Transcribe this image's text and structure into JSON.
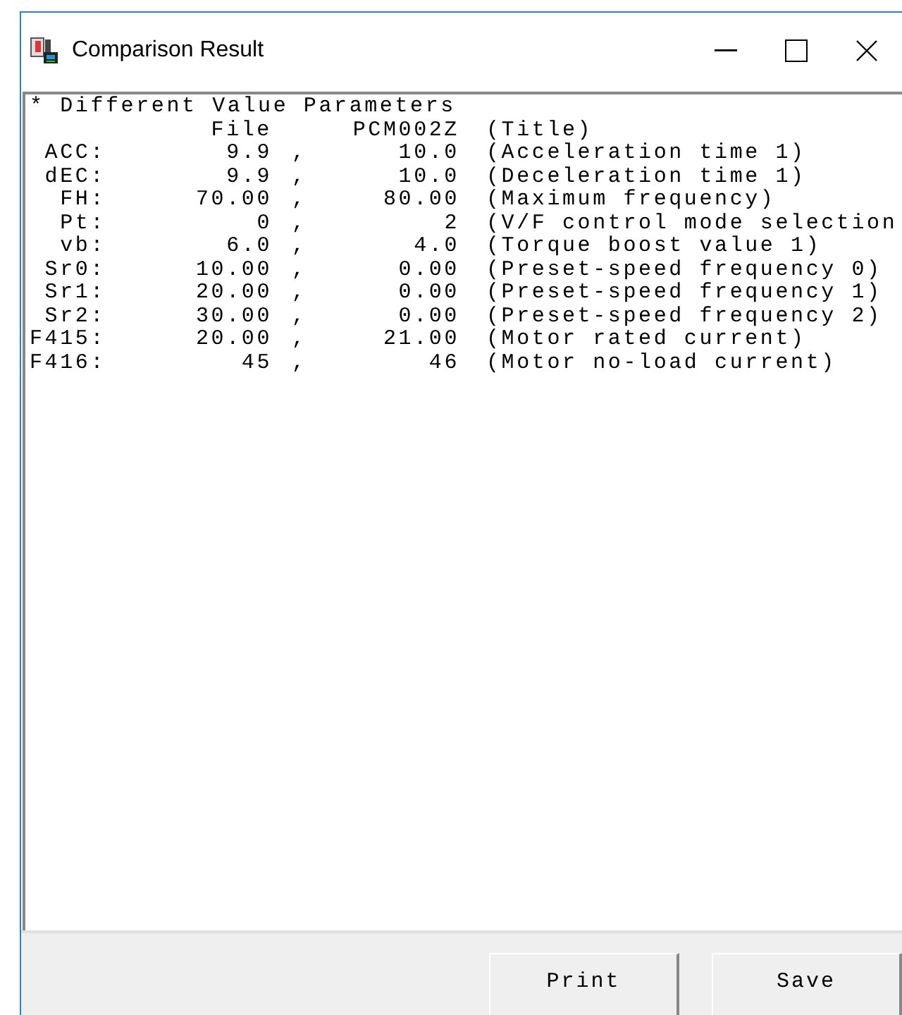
{
  "window": {
    "title": "Comparison Result"
  },
  "report": {
    "heading": "* Different Value Parameters",
    "columns": {
      "file": "File",
      "device": "PCM002Z",
      "description": "(Title)"
    },
    "rows": [
      {
        "name": "ACC:",
        "file": "9.9",
        "separator": ",",
        "device": "10.0",
        "description": "(Acceleration time 1)"
      },
      {
        "name": "dEC:",
        "file": "9.9",
        "separator": ",",
        "device": "10.0",
        "description": "(Deceleration time 1)"
      },
      {
        "name": "FH:",
        "file": "70.00",
        "separator": ",",
        "device": "80.00",
        "description": "(Maximum frequency)"
      },
      {
        "name": "Pt:",
        "file": "0",
        "separator": ",",
        "device": "2",
        "description": "(V/F control mode selection"
      },
      {
        "name": "vb:",
        "file": "6.0",
        "separator": ",",
        "device": "4.0",
        "description": "(Torque boost value 1)"
      },
      {
        "name": "Sr0:",
        "file": "10.00",
        "separator": ",",
        "device": "0.00",
        "description": "(Preset-speed frequency 0)"
      },
      {
        "name": "Sr1:",
        "file": "20.00",
        "separator": ",",
        "device": "0.00",
        "description": "(Preset-speed frequency 1)"
      },
      {
        "name": "Sr2:",
        "file": "30.00",
        "separator": ",",
        "device": "0.00",
        "description": "(Preset-speed frequency 2)"
      },
      {
        "name": "F415:",
        "file": "20.00",
        "separator": ",",
        "device": "21.00",
        "description": "(Motor rated current)"
      },
      {
        "name": "F416:",
        "file": "45",
        "separator": ",",
        "device": "46",
        "description": "(Motor no-load current)"
      }
    ]
  },
  "buttons": [
    {
      "label": "Print"
    },
    {
      "label": "Save"
    }
  ]
}
